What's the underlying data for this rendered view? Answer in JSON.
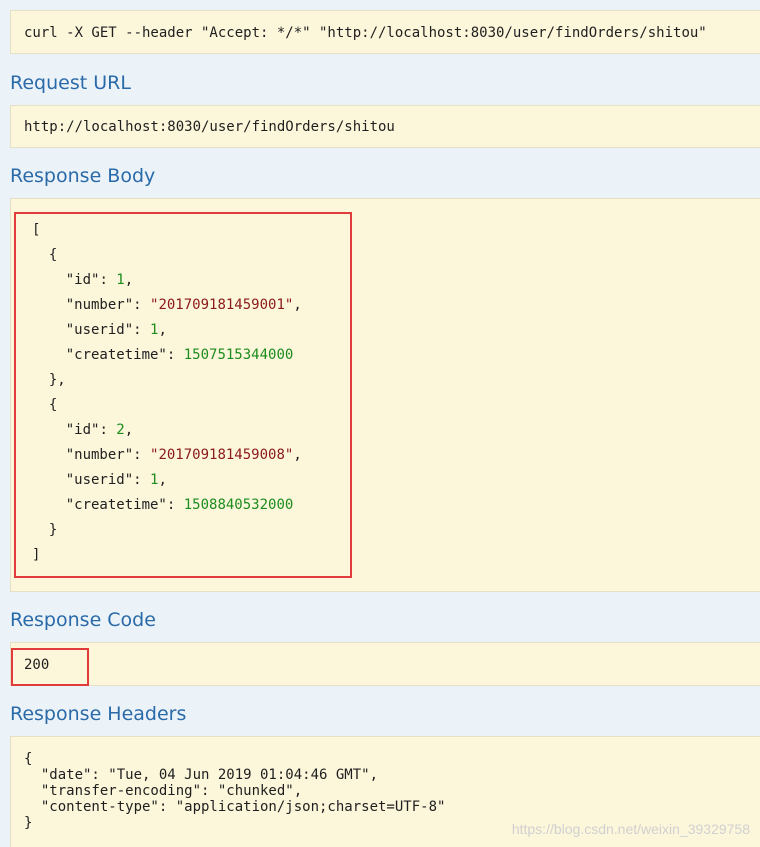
{
  "curl": {
    "command": "curl -X GET --header \"Accept: */*\" \"http://localhost:8030/user/findOrders/shitou\""
  },
  "request_url": {
    "heading": "Request URL",
    "value": "http://localhost:8030/user/findOrders/shitou"
  },
  "response_body": {
    "heading": "Response Body",
    "open_bracket": "[",
    "close_bracket": "]",
    "open_brace": "{",
    "close_brace_comma": "},",
    "close_brace": "}",
    "records": [
      {
        "id_key": "\"id\"",
        "id_value": "1",
        "number_key": "\"number\"",
        "number_value": "\"201709181459001\"",
        "userid_key": "\"userid\"",
        "userid_value": "1",
        "createtime_key": "\"createtime\"",
        "createtime_value": "1507515344000"
      },
      {
        "id_key": "\"id\"",
        "id_value": "2",
        "number_key": "\"number\"",
        "number_value": "\"201709181459008\"",
        "userid_key": "\"userid\"",
        "userid_value": "1",
        "createtime_key": "\"createtime\"",
        "createtime_value": "1508840532000"
      }
    ]
  },
  "response_code": {
    "heading": "Response Code",
    "value": "200"
  },
  "response_headers": {
    "heading": "Response Headers",
    "lines": [
      "{",
      "  \"date\": \"Tue, 04 Jun 2019 01:04:46 GMT\",",
      "  \"transfer-encoding\": \"chunked\",",
      "  \"content-type\": \"application/json;charset=UTF-8\"",
      "}"
    ]
  },
  "watermark": "https://blog.csdn.net/weixin_39329758",
  "colors": {
    "heading": "#2a6aa8",
    "panel_bg": "#fcf6db",
    "page_bg": "#ebf3f9",
    "highlight": "#e23b3b",
    "number": "#1c8c1c",
    "string": "#8b1a1a"
  }
}
